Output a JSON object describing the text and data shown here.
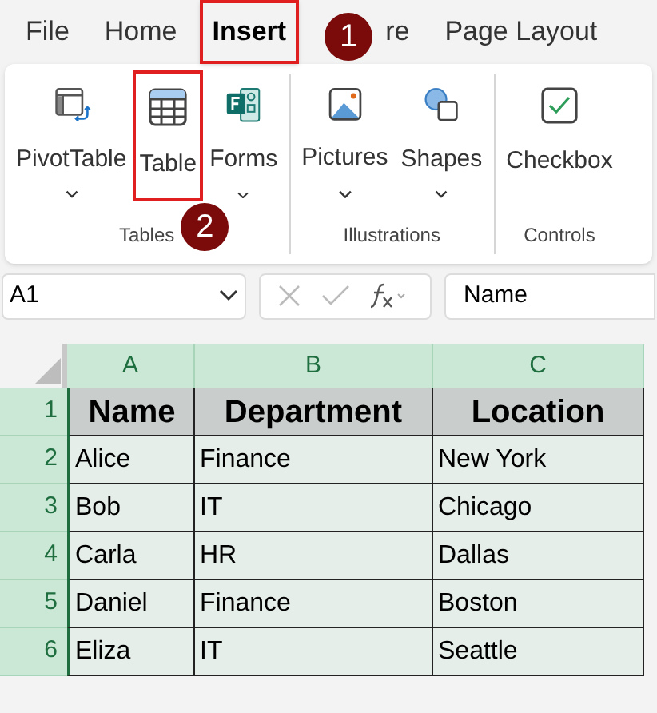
{
  "tabs": [
    {
      "label": "File",
      "selected": false,
      "highlighted": false
    },
    {
      "label": "Home",
      "selected": false,
      "highlighted": false
    },
    {
      "label": "Insert",
      "selected": true,
      "highlighted": true,
      "callout": "1"
    },
    {
      "label": "re",
      "selected": false,
      "highlighted": false
    },
    {
      "label": "Page Layout",
      "selected": false,
      "highlighted": false
    }
  ],
  "ribbon": [
    {
      "label": "Tables",
      "callout": "2",
      "buttons": [
        {
          "kind": "pivot",
          "label": "PivotTable",
          "dropdown": true,
          "highlighted": false
        },
        {
          "kind": "table",
          "label": "Table",
          "dropdown": false,
          "highlighted": true
        },
        {
          "kind": "forms",
          "label": "Forms",
          "dropdown": true,
          "highlighted": false
        }
      ]
    },
    {
      "label": "Illustrations",
      "buttons": [
        {
          "kind": "pictures",
          "label": "Pictures",
          "dropdown": true,
          "highlighted": false
        },
        {
          "kind": "shapes",
          "label": "Shapes",
          "dropdown": true,
          "highlighted": false
        }
      ]
    },
    {
      "label": "Controls",
      "buttons": [
        {
          "kind": "checkbox",
          "label": "Checkbox",
          "dropdown": false,
          "highlighted": false
        }
      ]
    }
  ],
  "name_box": "A1",
  "formula": "Name",
  "sheet": {
    "columns": [
      "A",
      "B",
      "C"
    ],
    "row_numbers": [
      "1",
      "2",
      "3",
      "4",
      "5",
      "6"
    ],
    "header": [
      "Name",
      "Department",
      "Location"
    ],
    "rows": [
      [
        "Alice",
        "Finance",
        "New York"
      ],
      [
        "Bob",
        "IT",
        "Chicago"
      ],
      [
        "Carla",
        "HR",
        "Dallas"
      ],
      [
        "Daniel",
        "Finance",
        "Boston"
      ],
      [
        "Eliza",
        "IT",
        "Seattle"
      ]
    ]
  }
}
